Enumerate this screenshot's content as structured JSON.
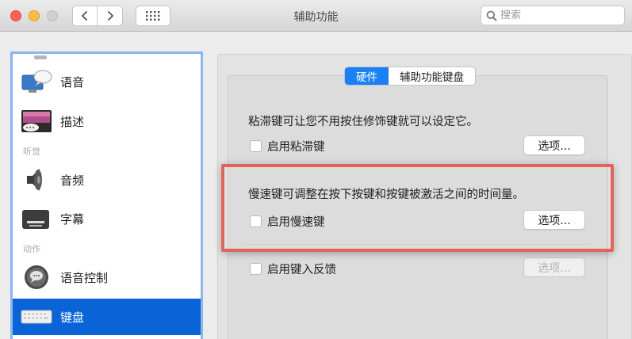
{
  "window": {
    "title": "辅助功能"
  },
  "toolbar": {
    "search_placeholder": "搜索",
    "back_icon": "chevron-left-icon",
    "forward_icon": "chevron-right-icon",
    "grid_icon": "show-all-grid-icon"
  },
  "sidebar": {
    "items": [
      {
        "label": "语音",
        "icon": "speech-bubble-display-icon"
      },
      {
        "label": "描述",
        "icon": "description-film-icon"
      },
      {
        "label": "音频",
        "icon": "speaker-icon"
      },
      {
        "label": "字幕",
        "icon": "captions-icon"
      },
      {
        "label": "语音控制",
        "icon": "voice-control-icon"
      },
      {
        "label": "键盘",
        "icon": "keyboard-icon",
        "selected": true
      }
    ],
    "sections": {
      "hearing": "听觉",
      "motor": "动作"
    }
  },
  "tabs": [
    {
      "label": "硬件",
      "active": true
    },
    {
      "label": "辅助功能键盘",
      "active": false
    }
  ],
  "sticky_keys": {
    "description": "粘滞键可让您不用按住修饰键就可以设定它。",
    "checkbox_label": "启用粘滞键",
    "checked": false,
    "options_label": "选项..."
  },
  "slow_keys": {
    "description": "慢速键可调整在按下按键和按键被激活之间的时间量。",
    "checkbox_label": "启用慢速键",
    "checked": false,
    "options_label": "选项..."
  },
  "typing_feedback": {
    "checkbox_label": "启用键入反馈",
    "checked": false,
    "options_label": "选项...",
    "options_enabled": false
  },
  "colors": {
    "accent": "#1a81f5",
    "sidebar_selected": "#0a64d8",
    "highlight_box": "#e0645c"
  }
}
